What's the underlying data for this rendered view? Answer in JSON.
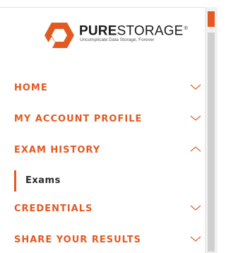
{
  "brand": {
    "name_bold": "PURE",
    "name_light": "STORAGE",
    "trademark": "®",
    "tagline": "Uncomplicate Data Storage, Forever",
    "accent_color": "#e25a22"
  },
  "nav": {
    "items": [
      {
        "label": "HOME",
        "state": "collapsed",
        "icon": "chevron-down-icon"
      },
      {
        "label": "MY ACCOUNT PROFILE",
        "state": "collapsed",
        "icon": "chevron-down-icon"
      },
      {
        "label": "EXAM HISTORY",
        "state": "expanded",
        "icon": "chevron-up-icon",
        "children": [
          {
            "label": "Exams",
            "active": true
          }
        ]
      },
      {
        "label": "CREDENTIALS",
        "state": "collapsed",
        "icon": "chevron-down-icon"
      },
      {
        "label": "SHARE YOUR RESULTS",
        "state": "collapsed",
        "icon": "chevron-down-icon"
      }
    ]
  }
}
